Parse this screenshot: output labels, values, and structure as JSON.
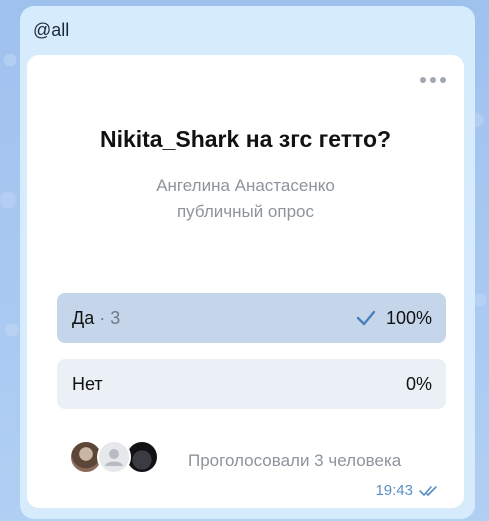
{
  "message": {
    "mention": "@all",
    "time": "19:43"
  },
  "poll": {
    "question": "Nikita_Shark на згс гетто?",
    "author": "Ангелина Анастасенко",
    "type": "публичный опрос",
    "options": [
      {
        "label": "Да",
        "count": "· 3",
        "percent": "100%",
        "fill": 1.0,
        "selected": true
      },
      {
        "label": "Нет",
        "count": "",
        "percent": "0%",
        "fill": 0.0,
        "selected": false
      }
    ],
    "voters_text": "Проголосовали 3 человека"
  },
  "icons": {
    "more": "more-dots-icon",
    "check": "checkmark-icon",
    "read": "double-check-icon",
    "placeholder_avatar": "user-silhouette-icon"
  },
  "colors": {
    "selected_fill": "#c5d6ea",
    "option_bg": "#ebf0f6",
    "accent": "#4a7fbf"
  }
}
